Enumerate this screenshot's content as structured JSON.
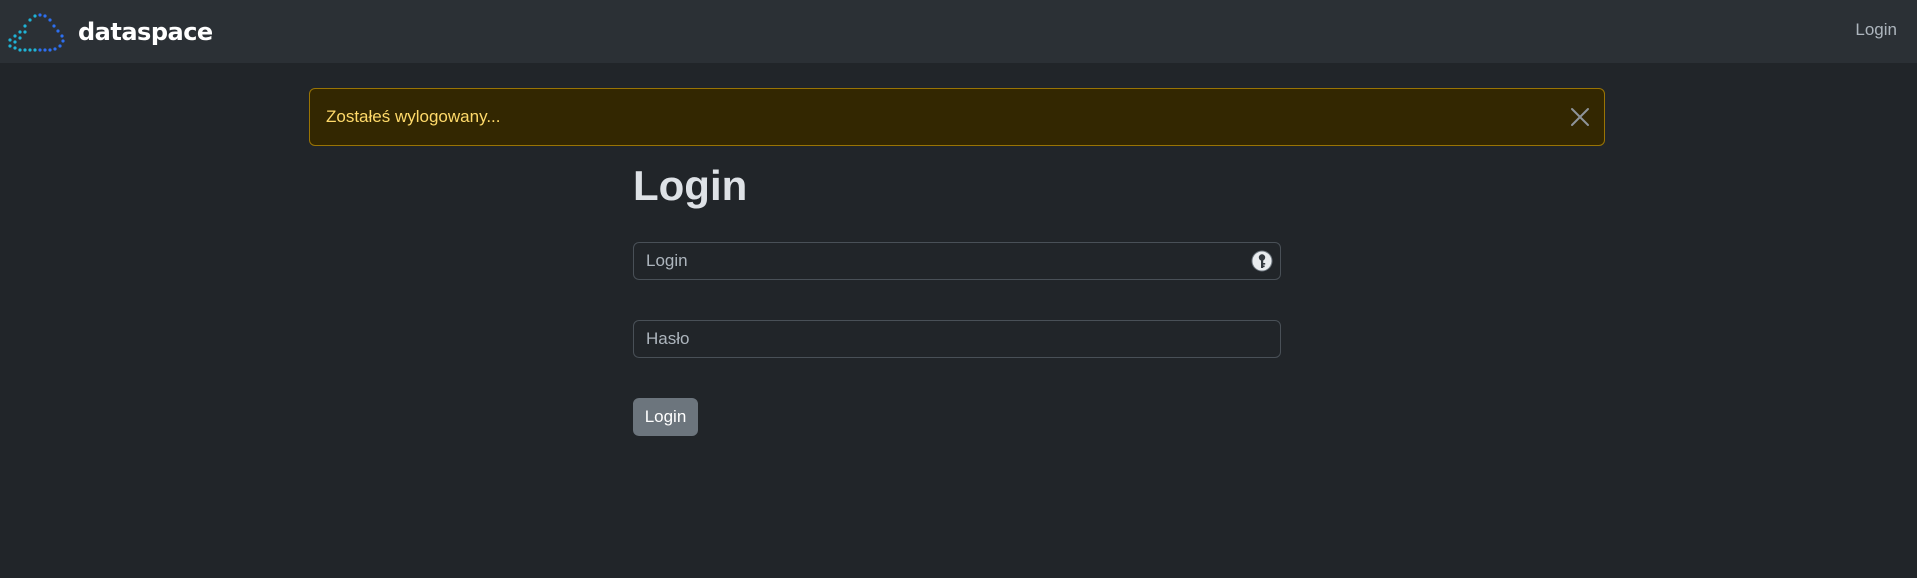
{
  "navbar": {
    "brand_name": "dataspace",
    "logo_icon": "cloud-dots-icon",
    "login_link": "Login"
  },
  "alert": {
    "message": "Zostałeś wylogowany...",
    "close_icon": "close-icon",
    "type": "warning"
  },
  "form": {
    "title": "Login",
    "login_placeholder": "Login",
    "password_placeholder": "Hasło",
    "password_manager_icon": "key-icon",
    "submit_label": "Login"
  },
  "colors": {
    "background": "#212529",
    "navbar": "#2b3035",
    "alert_bg": "#332701",
    "alert_border": "#997404",
    "alert_text": "#ffda6a",
    "button": "#6c757d",
    "logo_cyan": "#1fb3d6",
    "logo_blue": "#2d6ff0"
  }
}
